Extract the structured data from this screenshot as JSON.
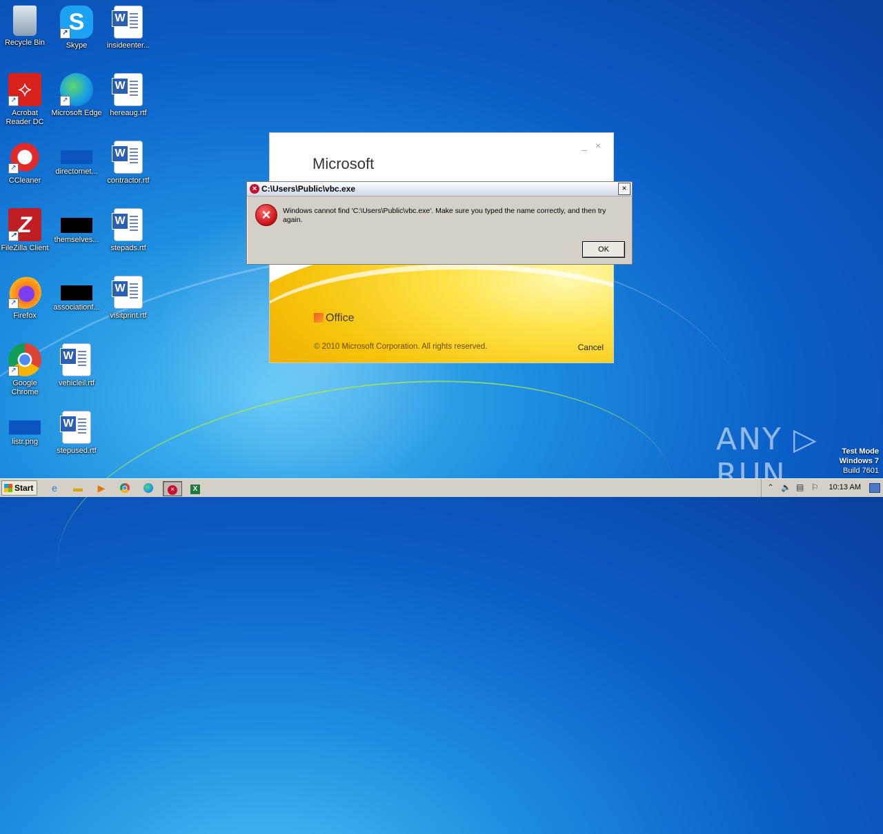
{
  "desktop": {
    "icons": [
      {
        "label": "Recycle Bin"
      },
      {
        "label": "Skype"
      },
      {
        "label": "insideenter..."
      },
      {
        "label": "Acrobat Reader DC"
      },
      {
        "label": "Microsoft Edge"
      },
      {
        "label": "hereaug.rtf"
      },
      {
        "label": "CCleaner"
      },
      {
        "label": "directornet..."
      },
      {
        "label": "contractor.rtf"
      },
      {
        "label": "FileZilla Client"
      },
      {
        "label": "themselves..."
      },
      {
        "label": "stepads.rtf"
      },
      {
        "label": "Firefox"
      },
      {
        "label": "associationf..."
      },
      {
        "label": "visitprint.rtf"
      },
      {
        "label": "Google Chrome"
      },
      {
        "label": "vehicleil.rtf"
      },
      {
        "label": "listr.png"
      },
      {
        "label": "stepused.rtf"
      }
    ]
  },
  "splash": {
    "brand": "Microsoft",
    "office_logo_text": "Office",
    "copyright": "© 2010 Microsoft Corporation.  All rights reserved.",
    "cancel_label": "Cancel",
    "controls": "_ ×"
  },
  "error_dialog": {
    "title": "C:\\Users\\Public\\vbc.exe",
    "message": "Windows cannot find 'C:\\Users\\Public\\vbc.exe'. Make sure you typed the name correctly, and then try again.",
    "ok_label": "OK",
    "close_glyph": "×",
    "icon_glyph": "×"
  },
  "watermark": {
    "anyrun": "ANY ▷ RUN",
    "line1": "Test Mode",
    "line2": "Windows 7",
    "line3": "Build 7601"
  },
  "taskbar": {
    "start_label": "Start",
    "clock": "10:13 AM"
  }
}
